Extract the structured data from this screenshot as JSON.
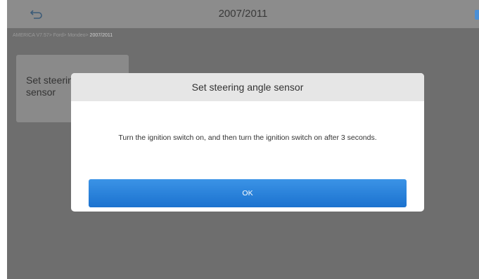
{
  "header": {
    "title": "2007/2011",
    "back_icon": "back-arrow-icon"
  },
  "breadcrumb": {
    "path": "AMERICA V7.57> Ford> Mondeo> ",
    "current": "2007/2011"
  },
  "function_tile": {
    "label": "Set steering angle sensor"
  },
  "dialog": {
    "title": "Set steering angle sensor",
    "message": "Turn the ignition switch on, and then turn the ignition switch on after 3 seconds.",
    "ok_label": "OK"
  },
  "colors": {
    "overlay": "#6e6e6e",
    "button": "#1b72cf",
    "dialog_header": "#e6e6e6"
  }
}
